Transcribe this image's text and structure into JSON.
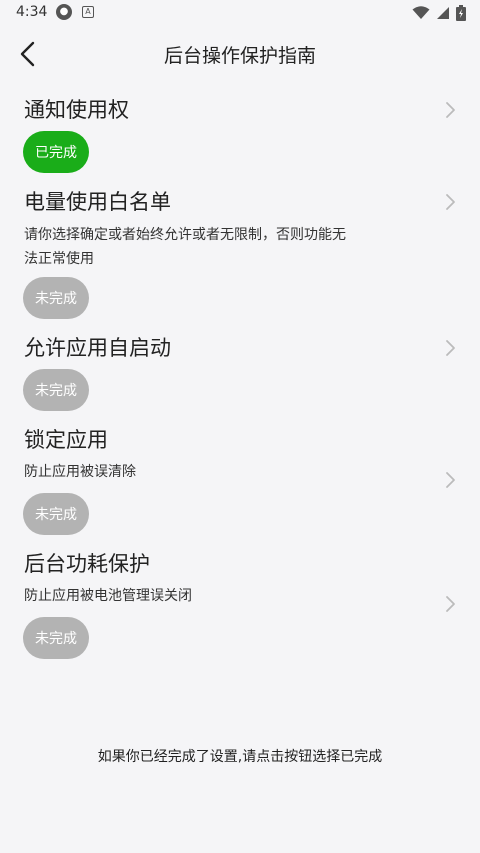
{
  "status_bar": {
    "time": "4:34",
    "icons": [
      "notification-round-icon",
      "accessibility-a-icon",
      "wifi-icon",
      "signal-icon",
      "battery-charging-icon"
    ]
  },
  "header": {
    "title": "后台操作保护指南",
    "back_icon": "chevron-left-icon"
  },
  "items": [
    {
      "title": "通知使用权",
      "desc": "",
      "status": "已完成",
      "done": true
    },
    {
      "title": "电量使用白名单",
      "desc": "请你选择确定或者始终允许或者无限制，否则功能无法正常使用",
      "status": "未完成",
      "done": false
    },
    {
      "title": "允许应用自启动",
      "desc": "",
      "status": "未完成",
      "done": false
    },
    {
      "title": "锁定应用",
      "desc": "防止应用被误清除",
      "status": "未完成",
      "done": false
    },
    {
      "title": "后台功耗保护",
      "desc": "防止应用被电池管理误关闭",
      "status": "未完成",
      "done": false
    }
  ],
  "footer": {
    "hint": "如果你已经完成了设置,请点击按钮选择已完成"
  },
  "colors": {
    "done": "#1aad19",
    "todo": "#b3b3b3",
    "background": "#f5f5f7"
  }
}
